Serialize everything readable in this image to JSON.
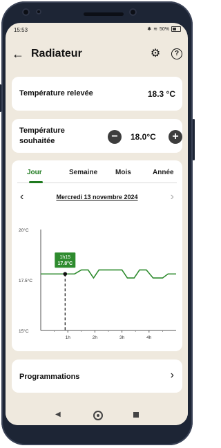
{
  "status": {
    "time": "15:53",
    "battery": "50%"
  },
  "appbar": {
    "title": "Radiateur",
    "back_icon": "arrow-left-icon",
    "settings_icon": "gear-icon",
    "help_icon": "help-icon"
  },
  "measured": {
    "label": "Température relevée",
    "value": "18.3 °C"
  },
  "target": {
    "label": "Température souhaitée",
    "value": "18.0°C",
    "minus": "−",
    "plus": "+"
  },
  "tabs": [
    {
      "label": "Jour",
      "active": true
    },
    {
      "label": "Semaine",
      "active": false
    },
    {
      "label": "Mois",
      "active": false
    },
    {
      "label": "Année",
      "active": false
    }
  ],
  "date": "Mercredi 13 novembre 2024",
  "chart_data": {
    "type": "line",
    "y_ticks": [
      "20°C",
      "17.5°C",
      "15°C"
    ],
    "ylim": [
      15,
      20
    ],
    "x_ticks": [
      "1h",
      "2h",
      "3h",
      "4h"
    ],
    "xlim": [
      0,
      5
    ],
    "color": "#2e8b2e",
    "series": [
      {
        "x": [
          0,
          0.9,
          1.25,
          1.5,
          1.75,
          1.95,
          2.15,
          3.0,
          3.2,
          3.45,
          3.65,
          3.9,
          4.15,
          4.5,
          4.7,
          5.0
        ],
        "y": [
          17.8,
          17.8,
          17.8,
          18.0,
          18.0,
          17.6,
          18.0,
          18.0,
          17.6,
          17.6,
          18.0,
          18.0,
          17.6,
          17.6,
          17.8,
          17.8
        ]
      }
    ],
    "marker": {
      "x": 0.9,
      "y": 17.8,
      "label_time": "1h15",
      "label_value": "17.8°C"
    }
  },
  "programmations": {
    "label": "Programmations"
  }
}
